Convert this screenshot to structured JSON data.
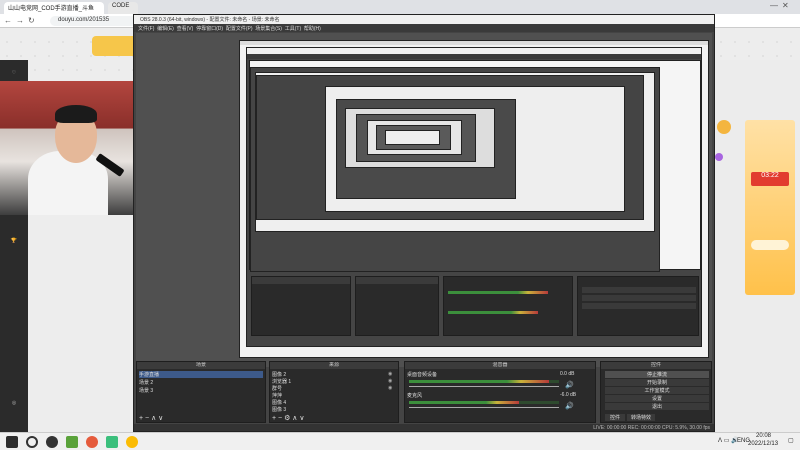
{
  "browser": {
    "tab1": "山山电竞网_COD手游直播_斗鱼",
    "tab2": "CODE",
    "url": "douyu.com/201535"
  },
  "obs": {
    "title": "OBS 28.0.3 (64-bit, windows) - 配置文件: 未命名 - 场景: 未命名",
    "menu": [
      "文件(F)",
      "编辑(E)",
      "查看(V)",
      "停靠窗口(D)",
      "配置文件(P)",
      "场景集合(S)",
      "工具(T)",
      "帮助(H)"
    ],
    "scenes_title": "场景",
    "scenes": [
      "手游直播",
      "场景 2",
      "场景 3"
    ],
    "sources_title": "来源",
    "sources": [
      "图像 2",
      "浏览器 1",
      "群号",
      "萍萍",
      "图像 4",
      "图像 3"
    ],
    "mixer_title": "混音器",
    "mixer": [
      {
        "name": "桌面音频设备",
        "db": "0.0 dB"
      },
      {
        "name": "麦克风",
        "db": "-6.0 dB"
      }
    ],
    "controls_title": "控件",
    "controls": [
      "停止推流",
      "开始录制",
      "工作室模式",
      "设置",
      "退出"
    ],
    "bottom_tabs": [
      "控件",
      "转场特效"
    ],
    "status": "LIVE: 00:00:00    REC: 00:00:00    CPU: 5.9%, 30.00 fps"
  },
  "taskbar": {
    "lang": "ENG",
    "time": "20:08",
    "date": "2022/12/13"
  },
  "ads": {
    "timer": "03:22",
    "small_timer": "03:22"
  },
  "colors": {
    "obs_bg": "#2a2a2a",
    "accent": "#3d5a8a",
    "live_red": "#c0392b"
  }
}
